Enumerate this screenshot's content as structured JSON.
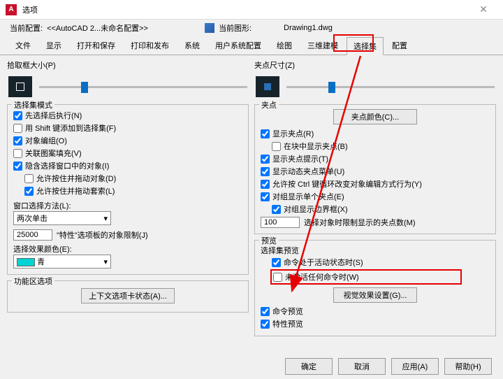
{
  "title": "选项",
  "infobar": {
    "profile_label": "当前配置:",
    "profile_value": "<<AutoCAD 2...未命名配置>>",
    "drawing_label": "当前图形:",
    "drawing_value": "Drawing1.dwg"
  },
  "tabs": [
    "文件",
    "显示",
    "打开和保存",
    "打印和发布",
    "系统",
    "用户系统配置",
    "绘图",
    "三维建模",
    "选择集",
    "配置"
  ],
  "left": {
    "pickbox_label": "拾取框大小(P)",
    "mode_title": "选择集模式",
    "cb_noun": "先选择后执行(N)",
    "cb_shift": "用 Shift 键添加到选择集(F)",
    "cb_objgroup": "对象编组(O)",
    "cb_hatch": "关联图案填充(V)",
    "cb_implied": "隐含选择窗口中的对象(I)",
    "cb_dragobj": "允许按住并拖动对象(D)",
    "cb_draglasso": "允许按住并拖动套索(L)",
    "winsel_label": "窗口选择方法(L):",
    "winsel_value": "两次单击",
    "limit_value": "25000",
    "limit_label": "\"特性\"选项板的对象限制(J)",
    "effcolor_label": "选择效果颜色(E):",
    "effcolor_value": "青",
    "ribbon_title": "功能区选项",
    "ribbon_btn": "上下文选项卡状态(A)..."
  },
  "right": {
    "gripsize_label": "夹点尺寸(Z)",
    "grip_title": "夹点",
    "gripcolor_btn": "夹点颜色(C)...",
    "cb_showgrip": "显示夹点(R)",
    "cb_blockgrip": "在块中显示夹点(B)",
    "cb_griptip": "显示夹点提示(T)",
    "cb_dynmenu": "显示动态夹点菜单(U)",
    "cb_ctrl": "允许按 Ctrl 键循环改变对象编辑方式行为(Y)",
    "cb_groupgrip": "对组显示单个夹点(E)",
    "cb_groupbbox": "对组显示边界框(X)",
    "gripobj_value": "100",
    "gripobj_label": "选择对象时限制显示的夹点数(M)",
    "preview_title": "预览",
    "preview_sub": "选择集预览",
    "cb_active": "命令处于活动状态时(S)",
    "cb_noactive": "未激活任何命令时(W)",
    "visual_btn": "视觉效果设置(G)...",
    "cb_cmdpreview": "命令预览",
    "cb_proppreview": "特性预览"
  },
  "footer": {
    "ok": "确定",
    "cancel": "取消",
    "apply": "应用(A)",
    "help": "帮助(H)"
  }
}
